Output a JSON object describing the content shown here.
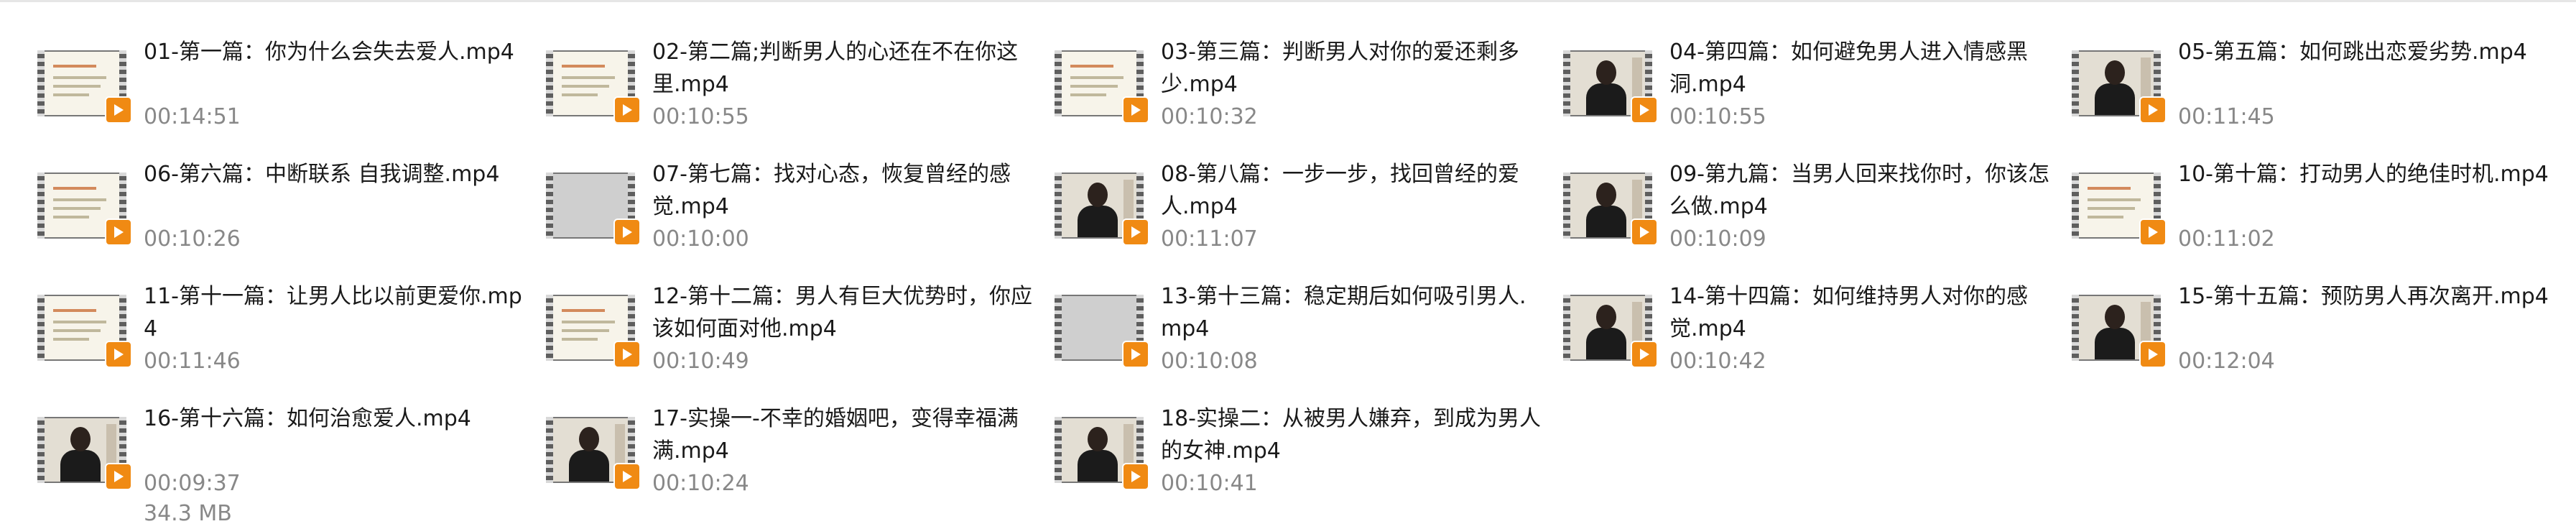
{
  "files": [
    {
      "name": "01-第一篇：你为什么会失去爱人.mp4",
      "duration": "00:14:51",
      "thumb": "slide"
    },
    {
      "name": "02-第二篇;判断男人的心还在不在你这里.mp4",
      "duration": "00:10:55",
      "thumb": "slide"
    },
    {
      "name": "03-第三篇：判断男人对你的爱还剩多少.mp4",
      "duration": "00:10:32",
      "thumb": "slide"
    },
    {
      "name": "04-第四篇：如何避免男人进入情感黑洞.mp4",
      "duration": "00:10:55",
      "thumb": "person"
    },
    {
      "name": "05-第五篇：如何跳出恋爱劣势.mp4",
      "duration": "00:11:45",
      "thumb": "person"
    },
    {
      "name": "06-第六篇：中断联系 自我调整.mp4",
      "duration": "00:10:26",
      "thumb": "slide"
    },
    {
      "name": "07-第七篇：找对心态，恢复曾经的感觉.mp4",
      "duration": "00:10:00",
      "thumb": "gray"
    },
    {
      "name": "08-第八篇：一步一步，找回曾经的爱人.mp4",
      "duration": "00:11:07",
      "thumb": "person"
    },
    {
      "name": "09-第九篇：当男人回来找你时，你该怎么做.mp4",
      "duration": "00:10:09",
      "thumb": "person"
    },
    {
      "name": "10-第十篇：打动男人的绝佳时机.mp4",
      "duration": "00:11:02",
      "thumb": "slide"
    },
    {
      "name": "11-第十一篇：让男人比以前更爱你.mp4",
      "duration": "00:11:46",
      "thumb": "slide"
    },
    {
      "name": "12-第十二篇：男人有巨大优势时，你应该如何面对他.mp4",
      "duration": "00:10:49",
      "thumb": "slide"
    },
    {
      "name": "13-第十三篇：稳定期后如何吸引男人.mp4",
      "duration": "00:10:08",
      "thumb": "gray"
    },
    {
      "name": "14-第十四篇：如何维持男人对你的感觉.mp4",
      "duration": "00:10:42",
      "thumb": "person"
    },
    {
      "name": "15-第十五篇：预防男人再次离开.mp4",
      "duration": "00:12:04",
      "thumb": "person"
    },
    {
      "name": "16-第十六篇：如何治愈爱人.mp4",
      "duration": "00:09:37",
      "size": "34.3 MB",
      "thumb": "person"
    },
    {
      "name": "17-实操一-不幸的婚姻吧，变得幸福满满.mp4",
      "duration": "00:10:24",
      "thumb": "person"
    },
    {
      "name": "18-实操二：从被男人嫌弃，到成为男人的女神.mp4",
      "duration": "00:10:41",
      "thumb": "person"
    }
  ],
  "colors": {
    "play_badge": "#f08a13",
    "title_text": "#1a1a1a",
    "meta_text": "#888888"
  },
  "icons": {
    "file_thumbnail": "video-thumbnail-icon",
    "play_badge": "play-icon"
  }
}
